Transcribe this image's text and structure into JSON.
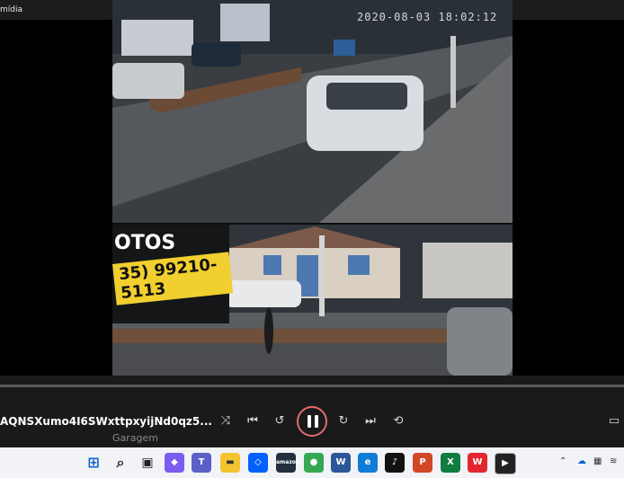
{
  "window": {
    "title": "mídia"
  },
  "video": {
    "timestamp": "2020-08-03 18:02:12",
    "sign_text_top": "OTOS",
    "sign_phone": "35) 99210-5113"
  },
  "player": {
    "file_name": "AQNSXumo4I6SWxttpxyijNd0qz5...",
    "subtitle": "Garagem",
    "progress": 0.0
  },
  "icons": {
    "shuffle": "shuffle-icon",
    "prev": "previous-icon",
    "back10": "rewind-10-icon",
    "pause": "pause-icon",
    "fwd30": "forward-30-icon",
    "next": "next-icon",
    "repeat": "repeat-off-icon",
    "cc": "captions-icon"
  },
  "taskbar": {
    "apps": [
      "windows-start-icon",
      "search-icon",
      "task-view-icon",
      "copilot-icon",
      "teams-icon",
      "file-explorer-icon",
      "dropbox-icon",
      "amazon-icon",
      "chrome-icon",
      "word-icon",
      "edge-icon",
      "tiktok-icon",
      "powerpoint-icon",
      "excel-icon",
      "wps-icon",
      "media-player-icon"
    ],
    "amazon_label": "amazon",
    "tray": [
      "chevron-up-icon",
      "onedrive-icon",
      "network-icon",
      "wifi-icon"
    ]
  }
}
